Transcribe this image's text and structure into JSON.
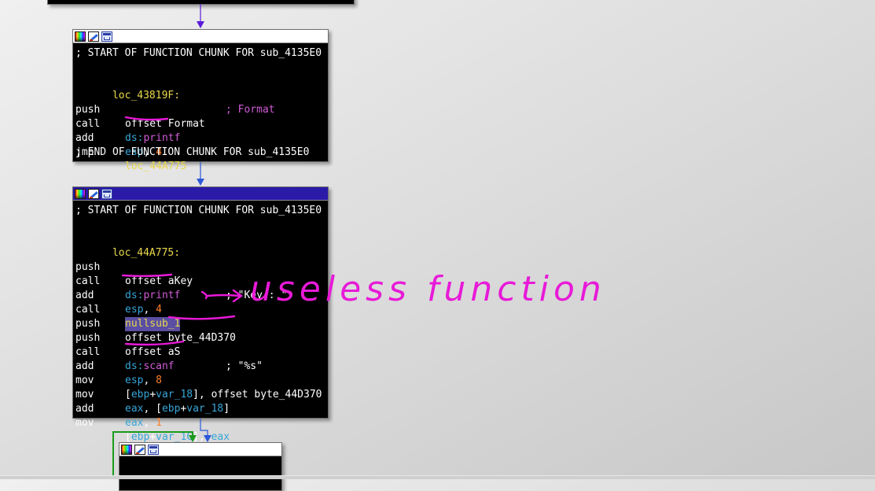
{
  "node1": {
    "lines": [
      {
        "text": "; START OF FUNCTION CHUNK FOR sub_4135E0"
      },
      {
        "text": ""
      },
      {
        "label": "loc_43819F:",
        "comment": "; Format"
      },
      {
        "mn": "push",
        "op": "offset Format"
      },
      {
        "mn": "call",
        "op1": "ds:",
        "op2": "printf"
      },
      {
        "mn": "add",
        "op1": "esp",
        "op2": ", ",
        "op3": "4"
      },
      {
        "mn": "jmp",
        "op": "loc_44A775"
      },
      {
        "text": "; END OF FUNCTION CHUNK FOR sub_4135E0"
      }
    ]
  },
  "node2": {
    "lines": [
      {
        "text": "; START OF FUNCTION CHUNK FOR sub_4135E0"
      },
      {
        "text": ""
      },
      {
        "label": "loc_44A775:"
      },
      {
        "mn": "push",
        "op1": "offset ",
        "op2": "aKey",
        "comment": "; \"Key : \""
      },
      {
        "mn": "call",
        "op1": "ds:",
        "op2": "printf"
      },
      {
        "mn": "add",
        "op1": "esp",
        "op2": ", ",
        "op3": "4"
      },
      {
        "mn": "call",
        "op": "nullsub_1"
      },
      {
        "mn": "push",
        "op1": "offset ",
        "op2": "byte_44D370"
      },
      {
        "mn": "push",
        "op1": "offset ",
        "op2": "aS",
        "comment": "; \"%s\""
      },
      {
        "mn": "call",
        "op1": "ds:",
        "op2": "scanf"
      },
      {
        "mn": "add",
        "op1": "esp",
        "op2": ", ",
        "op3": "8"
      },
      {
        "mn": "mov",
        "a": "[",
        "b": "ebp",
        "c": "+",
        "d": "var_18",
        "e": "], offset byte_44D370"
      },
      {
        "mn": "mov",
        "a": "eax",
        "b": ", [",
        "c": "ebp",
        "d": "+",
        "e": "var_18",
        "f": "]"
      },
      {
        "mn": "add",
        "a": "eax",
        "b": ", ",
        "c": "1"
      },
      {
        "mn": "mov",
        "a": "[",
        "b": "ebp",
        "c": "+",
        "d": "var_1C",
        "e": "], ",
        "f": "eax"
      }
    ]
  },
  "annotation": {
    "text": "useless function",
    "color": "#e81ad8"
  },
  "colors": {
    "background": "#dcdcdc",
    "node_bg": "#000000",
    "label": "#e9d84c",
    "register": "#36a5d8",
    "number": "#ff7f2a",
    "comment": "#d05bd6",
    "edge_blue": "#2b58d9",
    "edge_green": "#1a9a1a",
    "active_header": "#2a1aa8"
  }
}
